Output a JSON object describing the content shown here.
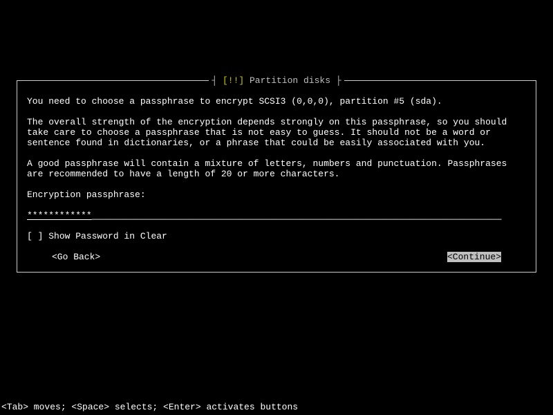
{
  "dialog": {
    "title_left": "┤ ",
    "title_bang": "[!!]",
    "title_text": " Partition disks ",
    "title_right": "├",
    "para1": "You need to choose a passphrase to encrypt SCSI3 (0,0,0), partition #5 (sda).",
    "para2": "The overall strength of the encryption depends strongly on this passphrase, so you should take care to choose a passphrase that is not easy to guess. It should not be a word or sentence found in dictionaries, or a phrase that could be easily associated with you.",
    "para3": "A good passphrase will contain a mixture of letters, numbers and punctuation. Passphrases are recommended to have a length of 20 or more characters.",
    "prompt_label": "Encryption passphrase:",
    "passphrase_masked": "************",
    "passphrase_fill": "____________________________________________________________________________",
    "show_clear_checked": false,
    "show_clear_prefix": "[ ] ",
    "show_clear_label": "Show Password in Clear",
    "go_back_label": "<Go Back>",
    "continue_label": "<Continue>"
  },
  "help_bar": "<Tab> moves; <Space> selects; <Enter> activates buttons"
}
